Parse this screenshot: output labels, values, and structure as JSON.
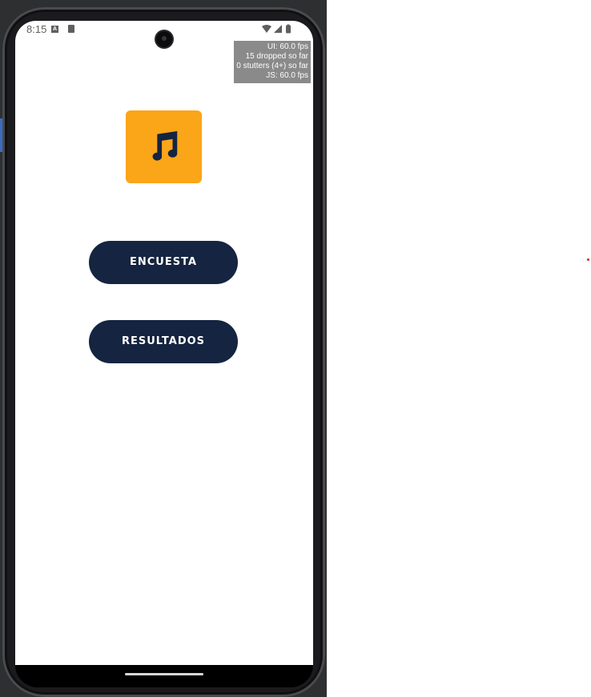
{
  "status_bar": {
    "time": "8:15",
    "notification_a": "A",
    "icons": [
      "a-notification-icon",
      "sd-card-icon",
      "wifi-icon",
      "signal-icon",
      "battery-icon"
    ]
  },
  "perf_monitor": {
    "line1": "UI: 60.0 fps",
    "line2": "15 dropped so far",
    "line3": "0 stutters (4+) so far",
    "line4": "JS: 60.0 fps"
  },
  "logo": {
    "icon": "music-note-icon",
    "background_color": "#fba519",
    "icon_color": "#152440"
  },
  "buttons": {
    "encuesta_label": "ENCUESTA",
    "resultados_label": "RESULTADOS",
    "color": "#152440"
  }
}
